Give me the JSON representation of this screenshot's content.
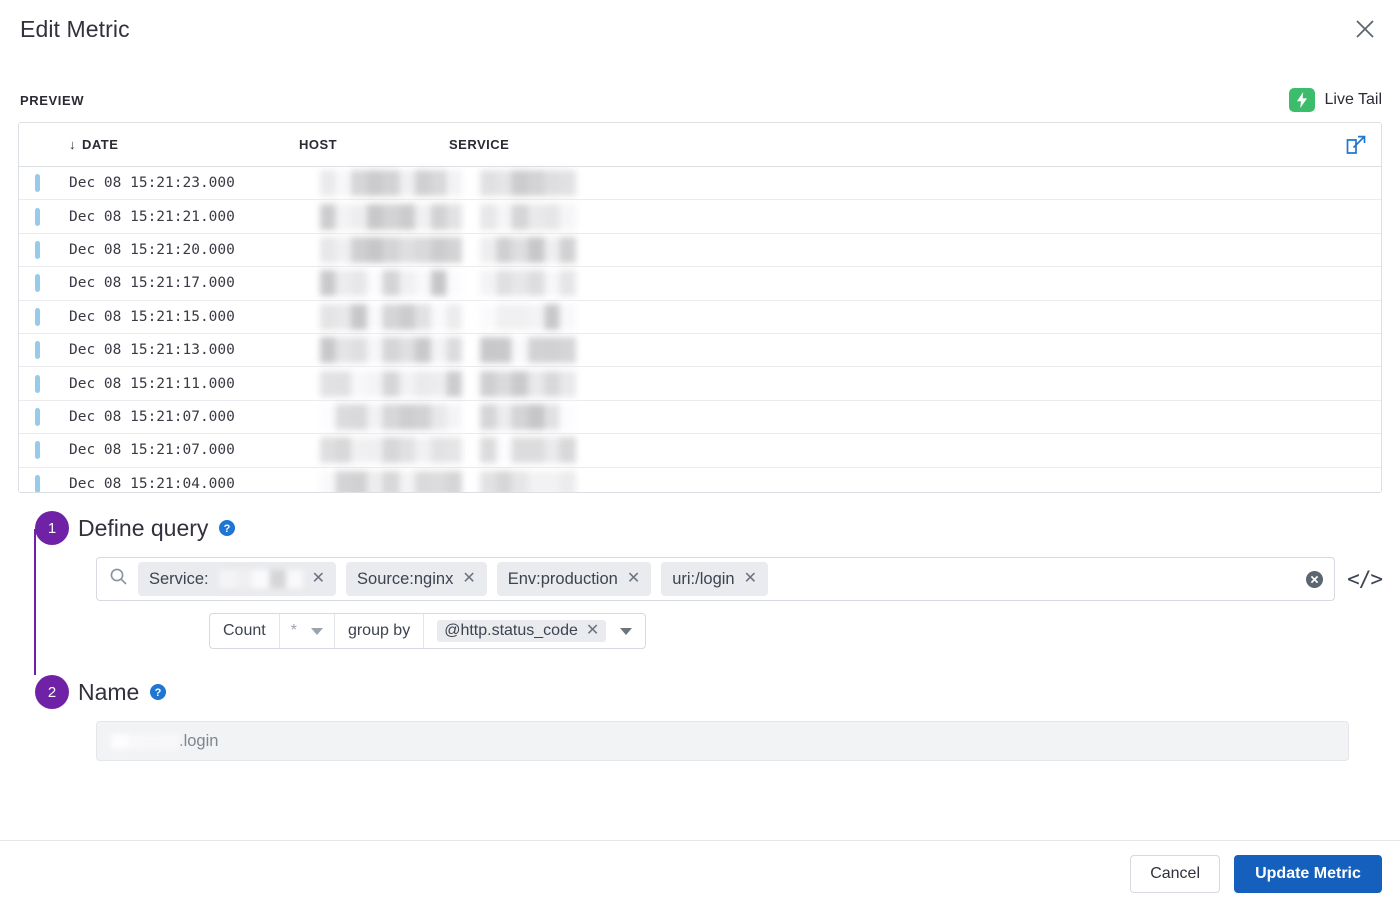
{
  "modal": {
    "title": "Edit Metric",
    "close_icon": "close-icon"
  },
  "preview": {
    "label": "PREVIEW",
    "live_tail_label": "Live Tail",
    "live_tail_icon": "lightning-bolt-icon",
    "live_tail_color": "#3cbd6c",
    "export_icon": "external-link-icon"
  },
  "log_table": {
    "sort_indicator": "↓",
    "columns": [
      "DATE",
      "HOST",
      "SERVICE"
    ],
    "rows": [
      {
        "date": "Dec 08 15:21:23.000",
        "host": "[redacted]",
        "service": "[redacted]"
      },
      {
        "date": "Dec 08 15:21:21.000",
        "host": "[redacted]",
        "service": "[redacted]"
      },
      {
        "date": "Dec 08 15:21:20.000",
        "host": "[redacted]",
        "service": "[redacted]"
      },
      {
        "date": "Dec 08 15:21:17.000",
        "host": "[redacted]",
        "service": "[redacted]"
      },
      {
        "date": "Dec 08 15:21:15.000",
        "host": "[redacted]",
        "service": "[redacted]"
      },
      {
        "date": "Dec 08 15:21:13.000",
        "host": "[redacted]",
        "service": "[redacted]"
      },
      {
        "date": "Dec 08 15:21:11.000",
        "host": "[redacted]",
        "service": "[redacted]"
      },
      {
        "date": "Dec 08 15:21:07.000",
        "host": "[redacted]",
        "service": "[redacted]"
      },
      {
        "date": "Dec 08 15:21:07.000",
        "host": "[redacted]",
        "service": "[redacted]"
      },
      {
        "date": "Dec 08 15:21:04.000",
        "host": "[redacted]",
        "service": "[redacted]"
      }
    ]
  },
  "steps": {
    "accent_color": "#6f22a6",
    "step1": {
      "number": "1",
      "title": "Define query",
      "help_icon": "help-circle-icon"
    },
    "step2": {
      "number": "2",
      "title": "Name",
      "help_icon": "help-circle-icon"
    }
  },
  "query": {
    "search_icon": "search-icon",
    "chips": [
      {
        "label": "Service:",
        "redacted_value": true
      },
      {
        "label": "Source:nginx",
        "redacted_value": false
      },
      {
        "label": "Env:production",
        "redacted_value": false
      },
      {
        "label": "uri:/login",
        "redacted_value": false
      }
    ],
    "clear_icon": "clear-circle-icon",
    "code_icon": "</>",
    "aggregation": {
      "function": "Count",
      "measure": "*",
      "group_by_label": "group by",
      "group_by_field": "@http.status_code"
    }
  },
  "name": {
    "value_suffix": ".login",
    "redacted_prefix": true
  },
  "footer": {
    "cancel_label": "Cancel",
    "submit_label": "Update Metric",
    "submit_color": "#1560bd"
  }
}
